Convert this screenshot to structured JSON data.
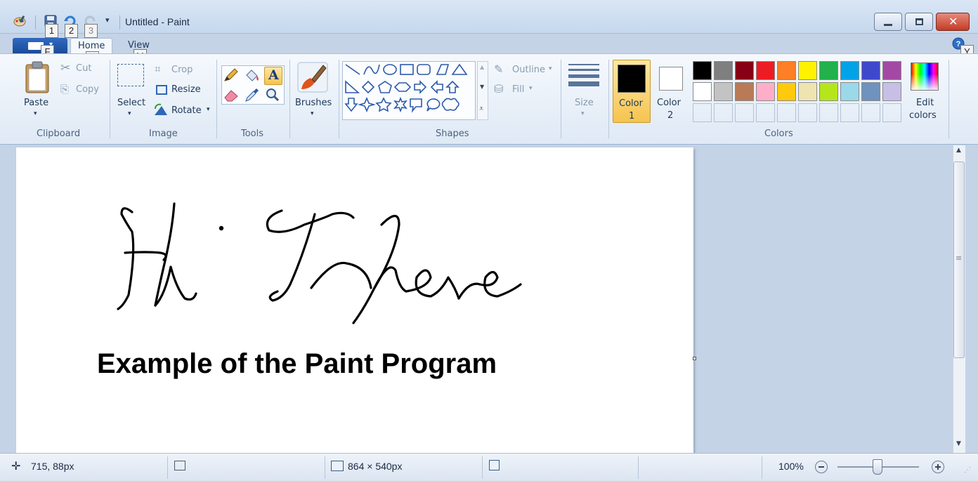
{
  "window": {
    "title": "Untitled - Paint"
  },
  "keytips": {
    "qa1": "1",
    "qa2": "2",
    "qa3": "3",
    "file": "F",
    "home": "H",
    "view": "V",
    "help": "Y"
  },
  "tabs": {
    "home": "Home",
    "view": "View"
  },
  "clipboard": {
    "paste": "Paste",
    "cut": "Cut",
    "copy": "Copy",
    "group": "Clipboard"
  },
  "image": {
    "select": "Select",
    "crop": "Crop",
    "resize": "Resize",
    "rotate": "Rotate",
    "group": "Image"
  },
  "tools": {
    "group": "Tools"
  },
  "brushes": {
    "label": "Brushes"
  },
  "shapes": {
    "outline": "Outline",
    "fill": "Fill",
    "group": "Shapes"
  },
  "size": {
    "label": "Size"
  },
  "colors": {
    "color1_label": "Color",
    "color1_num": "1",
    "color2_label": "Color",
    "color2_num": "2",
    "edit_line1": "Edit",
    "edit_line2": "colors",
    "group": "Colors",
    "color1_value": "#000000",
    "color2_value": "#ffffff",
    "palette_row1": [
      "#000000",
      "#7f7f7f",
      "#880015",
      "#ed1c24",
      "#ff7f27",
      "#fff200",
      "#22b14c",
      "#00a2e8",
      "#3f48cc",
      "#a349a4"
    ],
    "palette_row2": [
      "#ffffff",
      "#c3c3c3",
      "#b97a57",
      "#ffaec9",
      "#ffc90e",
      "#efe4b0",
      "#b5e61d",
      "#99d9ea",
      "#7092be",
      "#c8bfe7"
    ]
  },
  "canvas": {
    "text": "Example of the Paint Program"
  },
  "status": {
    "cursor_pos": "715, 88px",
    "image_size": "864 × 540px",
    "zoom": "100%"
  }
}
